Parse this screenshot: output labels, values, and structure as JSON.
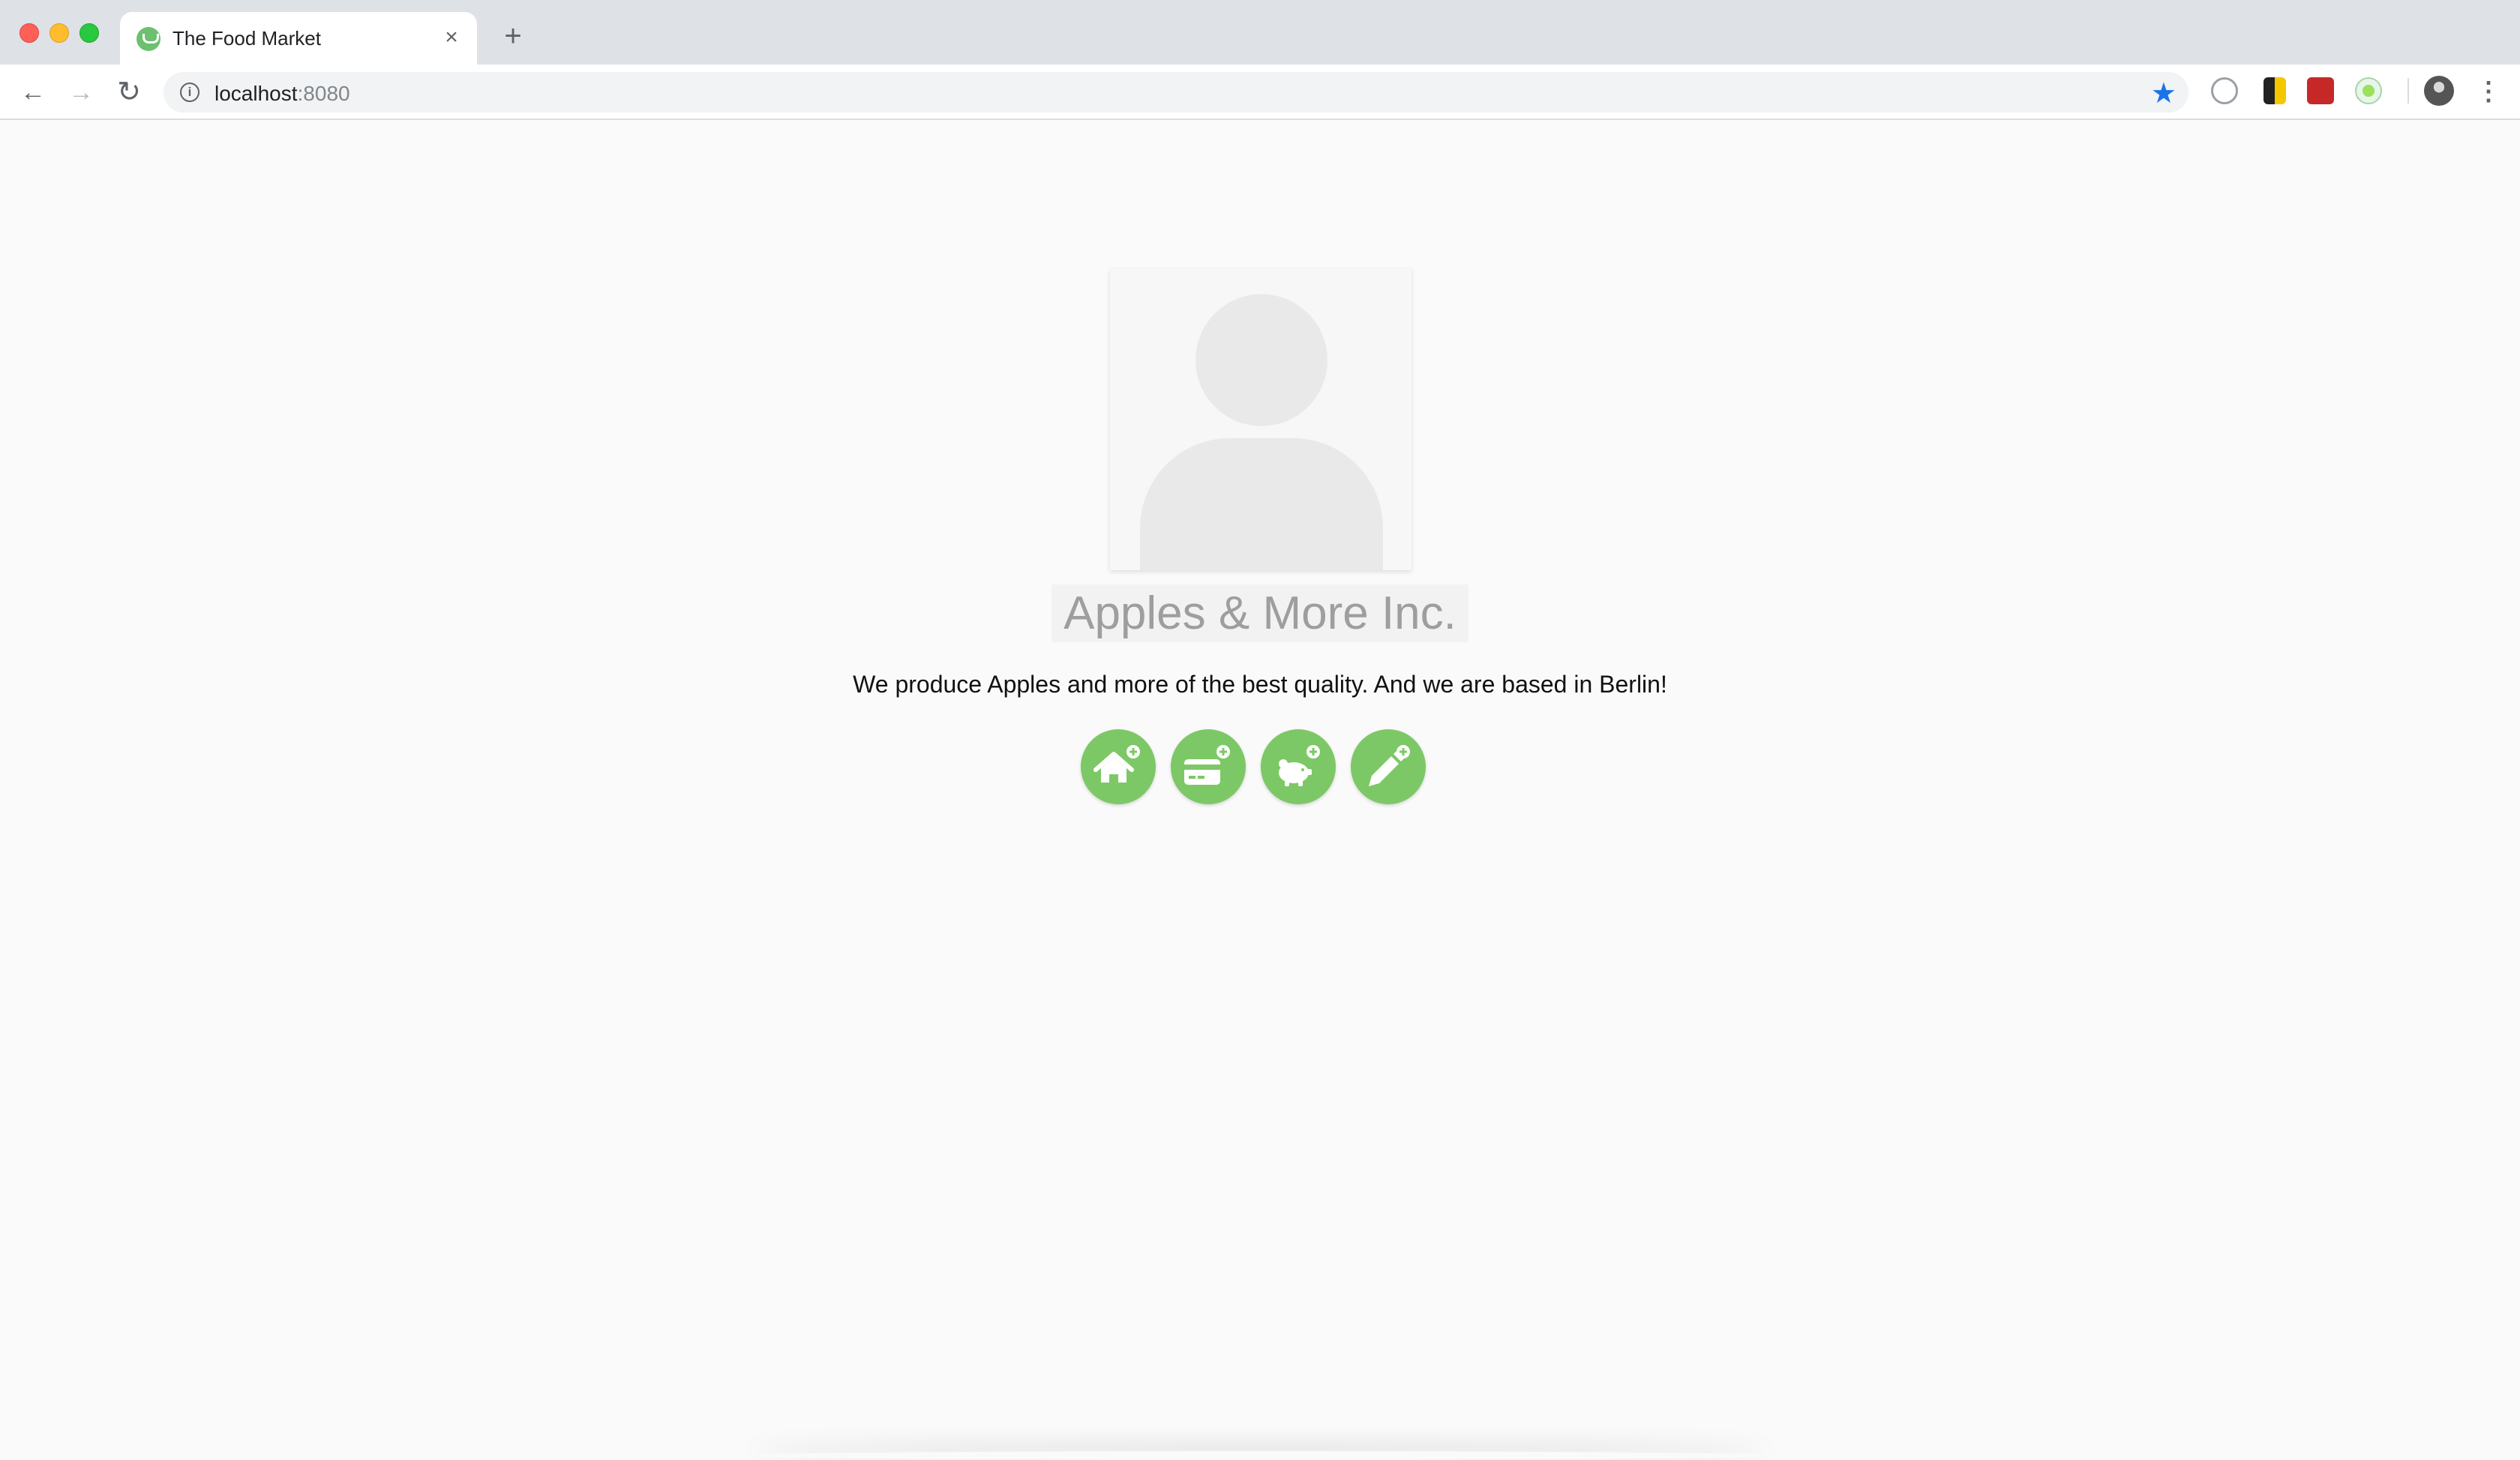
{
  "browser": {
    "tab_title": "The Food Market",
    "tab_close": "×",
    "new_tab": "+",
    "url_host": "localhost",
    "url_port": ":8080",
    "info_icon_glyph": "i",
    "menu_glyph": "⋮"
  },
  "profile": {
    "company_name": "Apples & More Inc.",
    "description": "We produce Apples and more of the best quality. And we are based in Berlin!"
  },
  "actions": [
    {
      "icon": "add-home-icon"
    },
    {
      "icon": "add-card-icon"
    },
    {
      "icon": "add-piggy-bank-icon"
    },
    {
      "icon": "add-edit-icon"
    }
  ],
  "colors": {
    "accent_green": "#7dc866",
    "page_background": "#fafafa",
    "title_gray": "#9e9e9e"
  }
}
